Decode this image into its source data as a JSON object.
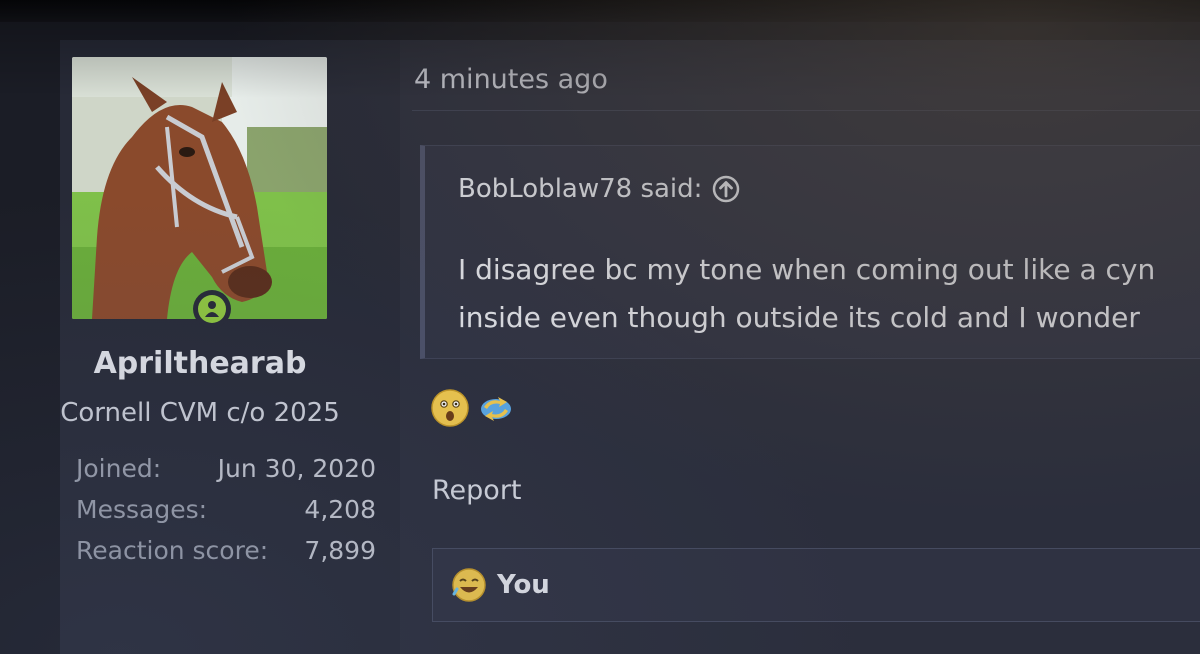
{
  "user": {
    "username": "Aprilthearab",
    "title": "Cornell CVM c/o 2025",
    "stats": [
      {
        "label": "Joined:",
        "value": "Jun 30, 2020"
      },
      {
        "label": "Messages:",
        "value": "4,208"
      },
      {
        "label": "Reaction score:",
        "value": "7,899"
      }
    ],
    "avatar_icon": "horse-avatar",
    "online_icon": "online-user-icon"
  },
  "post": {
    "timestamp": "4 minutes ago",
    "quote": {
      "author_label": "BobLoblaw78 said:",
      "author_icon": "arrow-up-circle-icon",
      "lines": [
        "I disagree bc my tone when coming out like a cyn",
        "inside even though outside its cold and I wonder"
      ]
    },
    "reactions": [
      {
        "icon": "wow-face-icon",
        "color": "#f2c94c"
      },
      {
        "icon": "sync-icon",
        "color": "#5aa8e6"
      }
    ],
    "report_label": "Report",
    "reaction_bar": {
      "icon": "laugh-face-icon",
      "label": "You"
    }
  },
  "colors": {
    "background": "#1b1d26",
    "panel": "#272a37",
    "post": "#2b2e3c",
    "online": "#8ec63f"
  }
}
